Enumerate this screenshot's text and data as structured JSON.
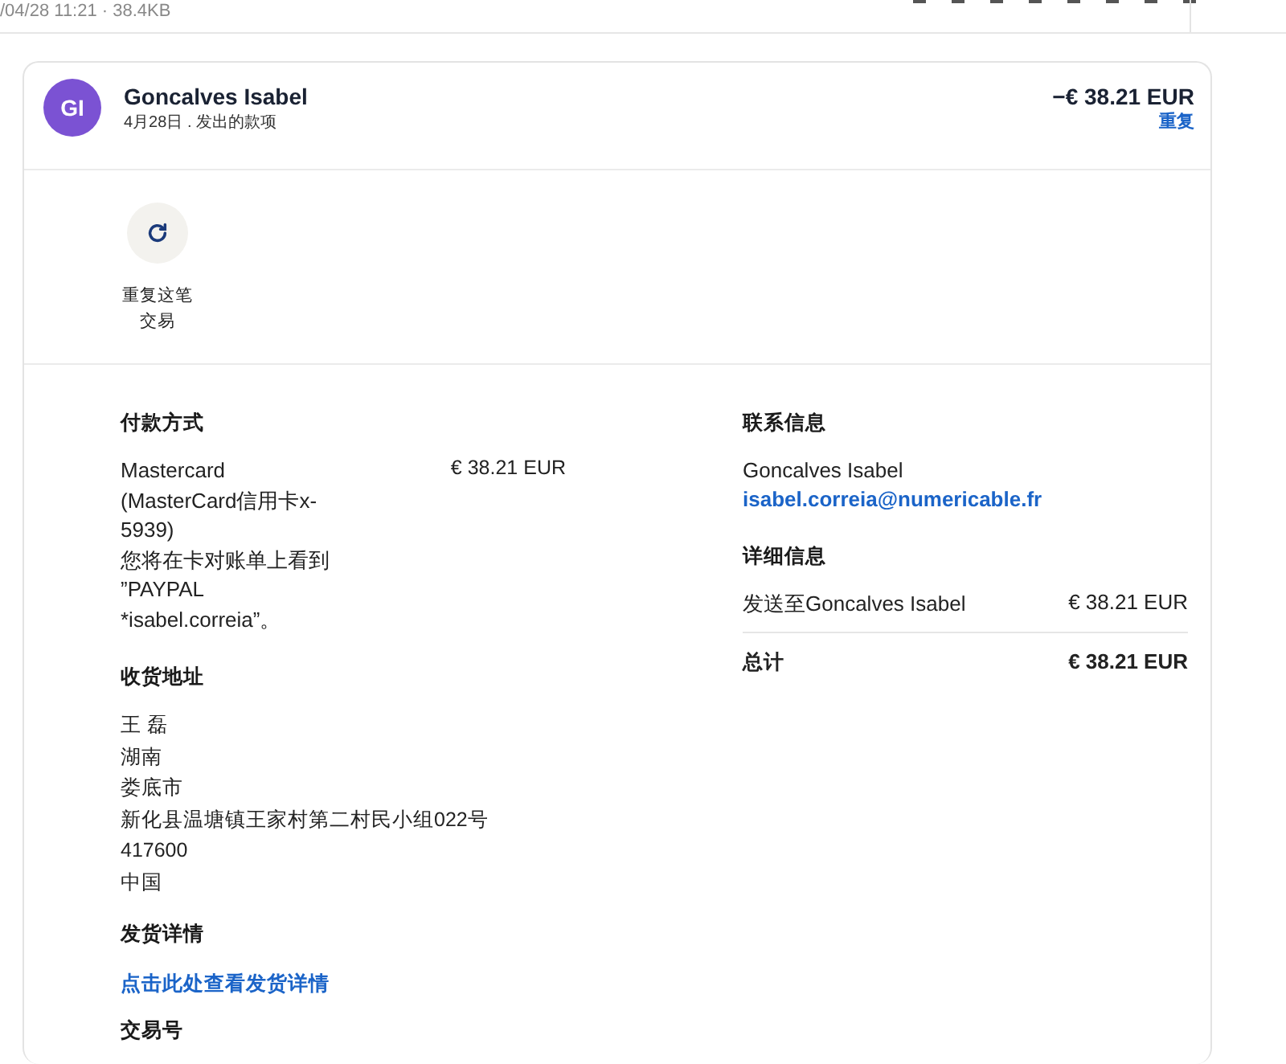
{
  "top_bar": {
    "file_info": "/04/28 11:21 · 38.4KB"
  },
  "header": {
    "avatar_initials": "GI",
    "name": "Goncalves Isabel",
    "subtitle": "4月28日 . 发出的款项",
    "amount": "−€ 38.21 EUR",
    "repeat_link": "重复"
  },
  "actions": [
    {
      "label": "重复这笔交易"
    }
  ],
  "payment": {
    "heading": "付款方式",
    "lines": [
      "Mastercard",
      "(MasterCard信用卡x-",
      "5939)",
      "您将在卡对账单上看到",
      "”PAYPAL",
      "*isabel.correia”。"
    ],
    "amount": "€ 38.21 EUR"
  },
  "shipping_address": {
    "heading": "收货地址",
    "lines": [
      "王 磊",
      "湖南",
      "娄底市",
      "新化县温塘镇王家村第二村民小组022号",
      "417600",
      "中国"
    ]
  },
  "shipping_details": {
    "heading": "发货详情",
    "link": "点击此处查看发货详情"
  },
  "transaction_id": {
    "heading": "交易号"
  },
  "contact": {
    "heading": "联系信息",
    "name": "Goncalves Isabel",
    "email": "isabel.correia@numericable.fr"
  },
  "details": {
    "heading": "详细信息",
    "rows": [
      {
        "kind": "item",
        "label": "发送至Goncalves Isabel",
        "amount": "€ 38.21 EUR"
      },
      {
        "kind": "total",
        "label": "总计",
        "amount": "€ 38.21 EUR"
      }
    ]
  }
}
